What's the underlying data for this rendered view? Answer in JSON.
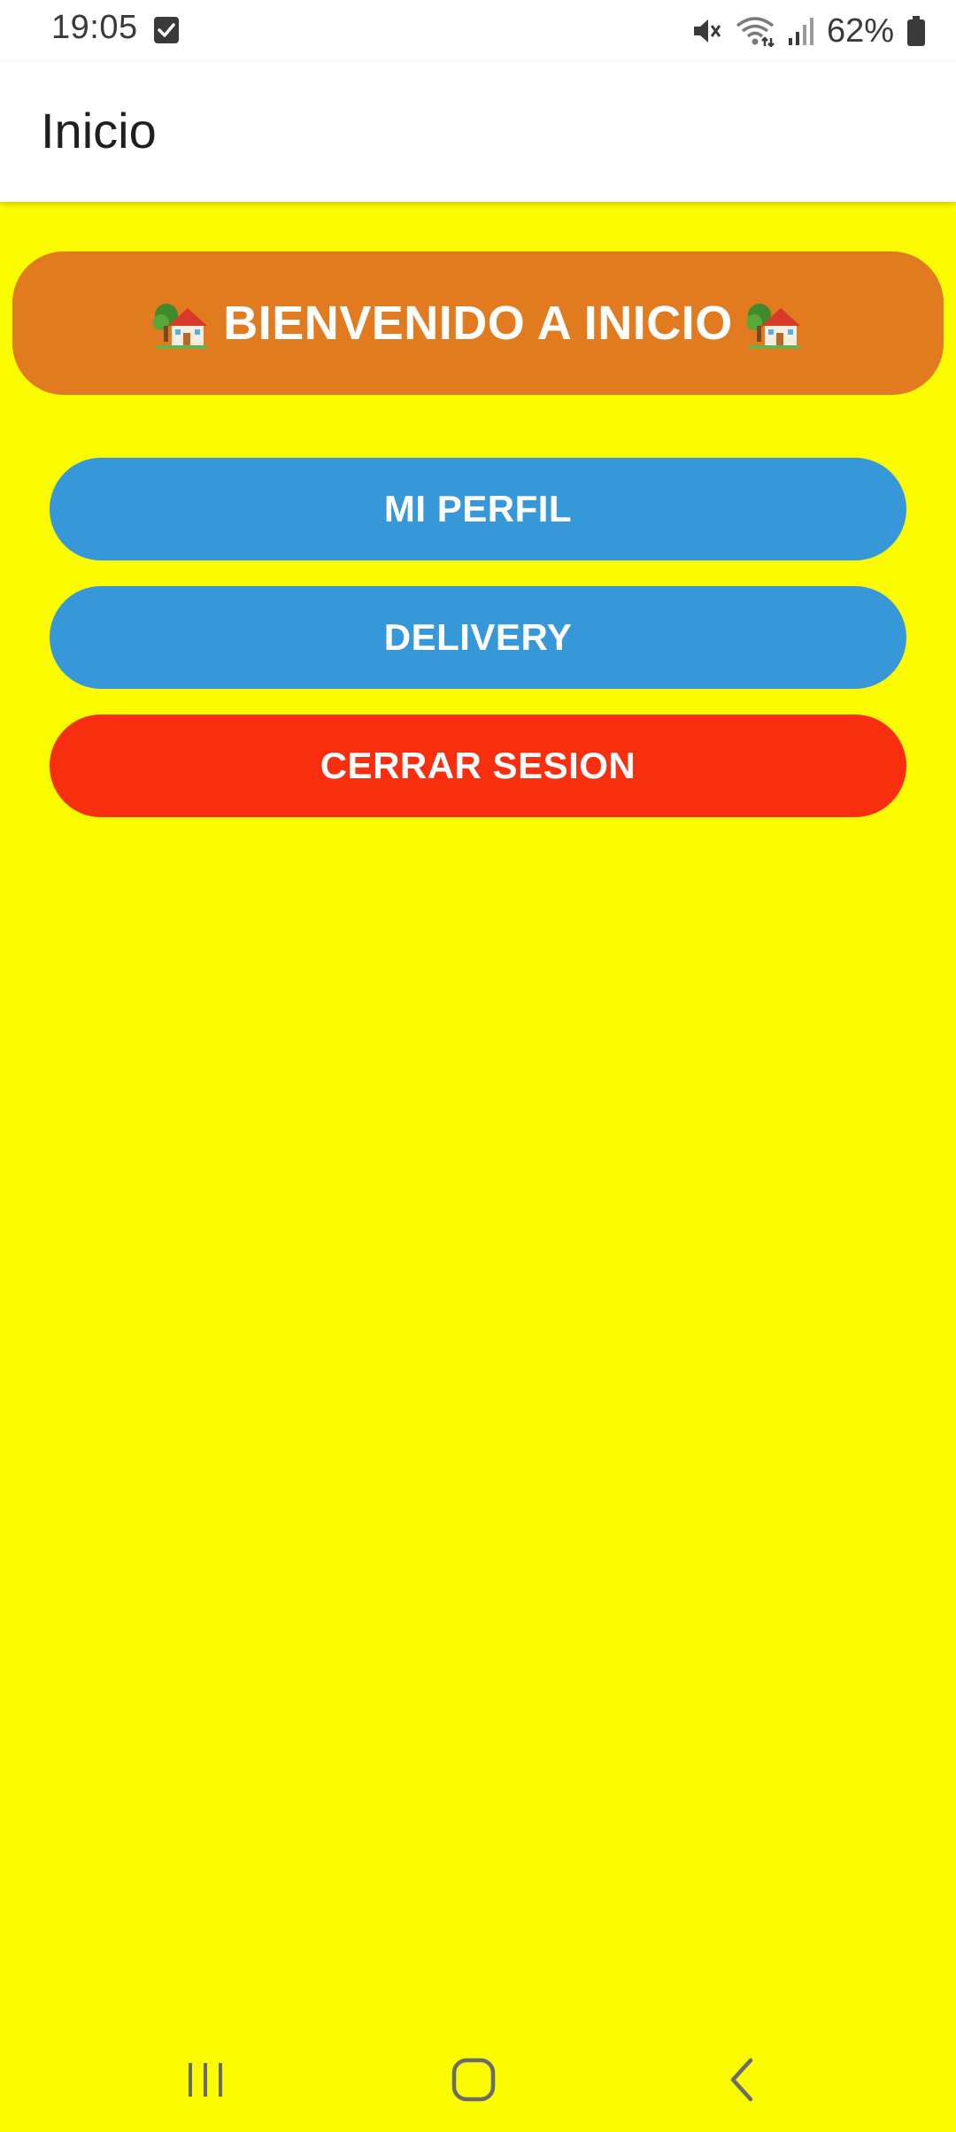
{
  "status_bar": {
    "time": "19:05",
    "battery_percent": "62%",
    "icons": [
      "checkbox-notification-icon",
      "mute-icon",
      "wifi-icon",
      "signal-icon",
      "battery-icon"
    ]
  },
  "app_bar": {
    "title": "Inicio"
  },
  "welcome": {
    "text": "BIENVENIDO A INICIO",
    "icon": "house-with-garden-icon"
  },
  "buttons": {
    "profile": "MI PERFIL",
    "delivery": "DELIVERY",
    "logout": "CERRAR SESION"
  },
  "colors": {
    "background": "#FCFC00",
    "banner": "#E27A20",
    "primary_button": "#3798D9",
    "logout_button": "#F92E0F"
  },
  "nav_bar": {
    "icons": [
      "recents-icon",
      "home-icon",
      "back-icon"
    ]
  }
}
